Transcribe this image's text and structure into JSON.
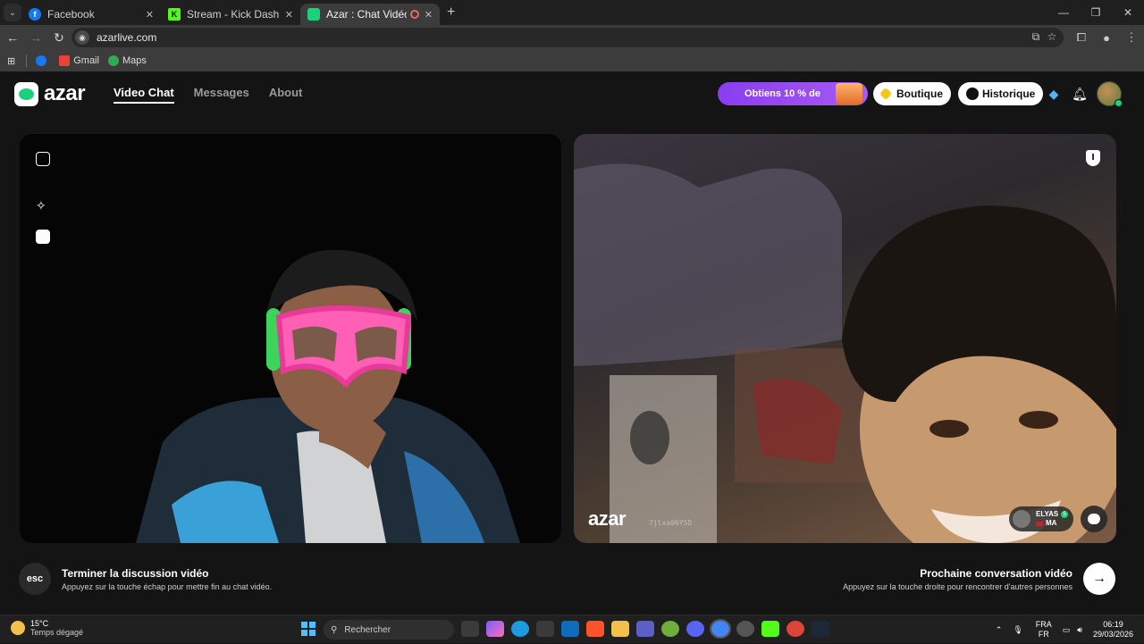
{
  "browser": {
    "tabs": [
      {
        "title": "Facebook",
        "icon": "facebook-icon",
        "color": "#1877f2",
        "active": false
      },
      {
        "title": "Stream - Kick Dashboard",
        "icon": "kick-icon",
        "color": "#53fc18",
        "active": false
      },
      {
        "title": "Azar : Chat Vidéo avec de n",
        "icon": "azar-icon",
        "color": "#19d27a",
        "active": true
      }
    ],
    "url": "azarlive.com",
    "bookmarks": [
      {
        "label": "",
        "icon": "facebook-icon",
        "color": "#1877f2"
      },
      {
        "label": "Gmail",
        "icon": "gmail-icon",
        "color": "#ea4335"
      },
      {
        "label": "Maps",
        "icon": "maps-icon",
        "color": "#34a853"
      }
    ]
  },
  "azar": {
    "logo": "azar",
    "nav": [
      {
        "label": "Video Chat",
        "active": true
      },
      {
        "label": "Messages",
        "active": false
      },
      {
        "label": "About",
        "active": false
      }
    ],
    "promo": "Obtiens 10 % de",
    "shop": "Boutique",
    "history": "Historique",
    "watermark": "azar",
    "watermark_id": "7jlxa06Y5D",
    "partner": {
      "name": "ELYAS",
      "country": "MA",
      "level": "5"
    },
    "end": {
      "key": "esc",
      "title": "Terminer la discussion vidéo",
      "subtitle": "Appuyez sur la touche échap pour mettre fin au chat vidéo."
    },
    "next": {
      "title": "Prochaine conversation vidéo",
      "subtitle": "Appuyez sur la touche droite pour rencontrer d'autres personnes"
    },
    "accent": "#19d27a",
    "promo_color": "#8a3df0"
  },
  "taskbar": {
    "temperature": "15°C",
    "weather": "Temps dégagé",
    "search_placeholder": "Rechercher",
    "lang_top": "FRA",
    "lang_bottom": "FR",
    "time": "06:19",
    "date": "29/03/2026"
  }
}
